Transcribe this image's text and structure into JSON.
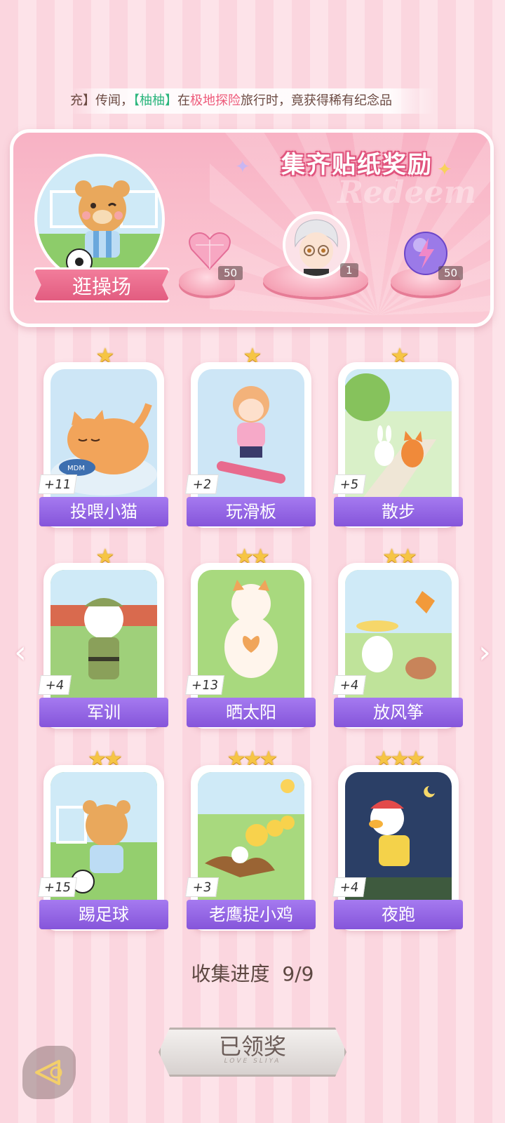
{
  "marquee": {
    "prefix": "充】传闻，",
    "user": "【柚柚】",
    "middle": "在",
    "place": "极地探险",
    "suffix": "旅行时，竟获得稀有纪念品"
  },
  "banner": {
    "title": "集齐贴纸奖励",
    "watermark": "Redeem",
    "location_label": "逛操场",
    "rewards": [
      {
        "name": "pink-heart-gem",
        "count": "50"
      },
      {
        "name": "character-avatar",
        "count": "1"
      },
      {
        "name": "purple-energy-orb",
        "count": "50"
      }
    ]
  },
  "cards": [
    {
      "label": "投喂小猫",
      "count": "+11",
      "stars": 1
    },
    {
      "label": "玩滑板",
      "count": "+2",
      "stars": 1
    },
    {
      "label": "散步",
      "count": "+5",
      "stars": 1
    },
    {
      "label": "军训",
      "count": "+4",
      "stars": 1
    },
    {
      "label": "晒太阳",
      "count": "+13",
      "stars": 2
    },
    {
      "label": "放风筝",
      "count": "+4",
      "stars": 2
    },
    {
      "label": "踢足球",
      "count": "+15",
      "stars": 2
    },
    {
      "label": "老鹰捉小鸡",
      "count": "+3",
      "stars": 3
    },
    {
      "label": "夜跑",
      "count": "+4",
      "stars": 3
    }
  ],
  "progress": {
    "label": "收集进度",
    "value": "9/9"
  },
  "claim_button": {
    "label": "已领奖",
    "sub": "LOVE SLIYA"
  },
  "colors": {
    "accent": "#8555da",
    "banner_pink": "#f27d9b",
    "star": "#f6c544"
  }
}
